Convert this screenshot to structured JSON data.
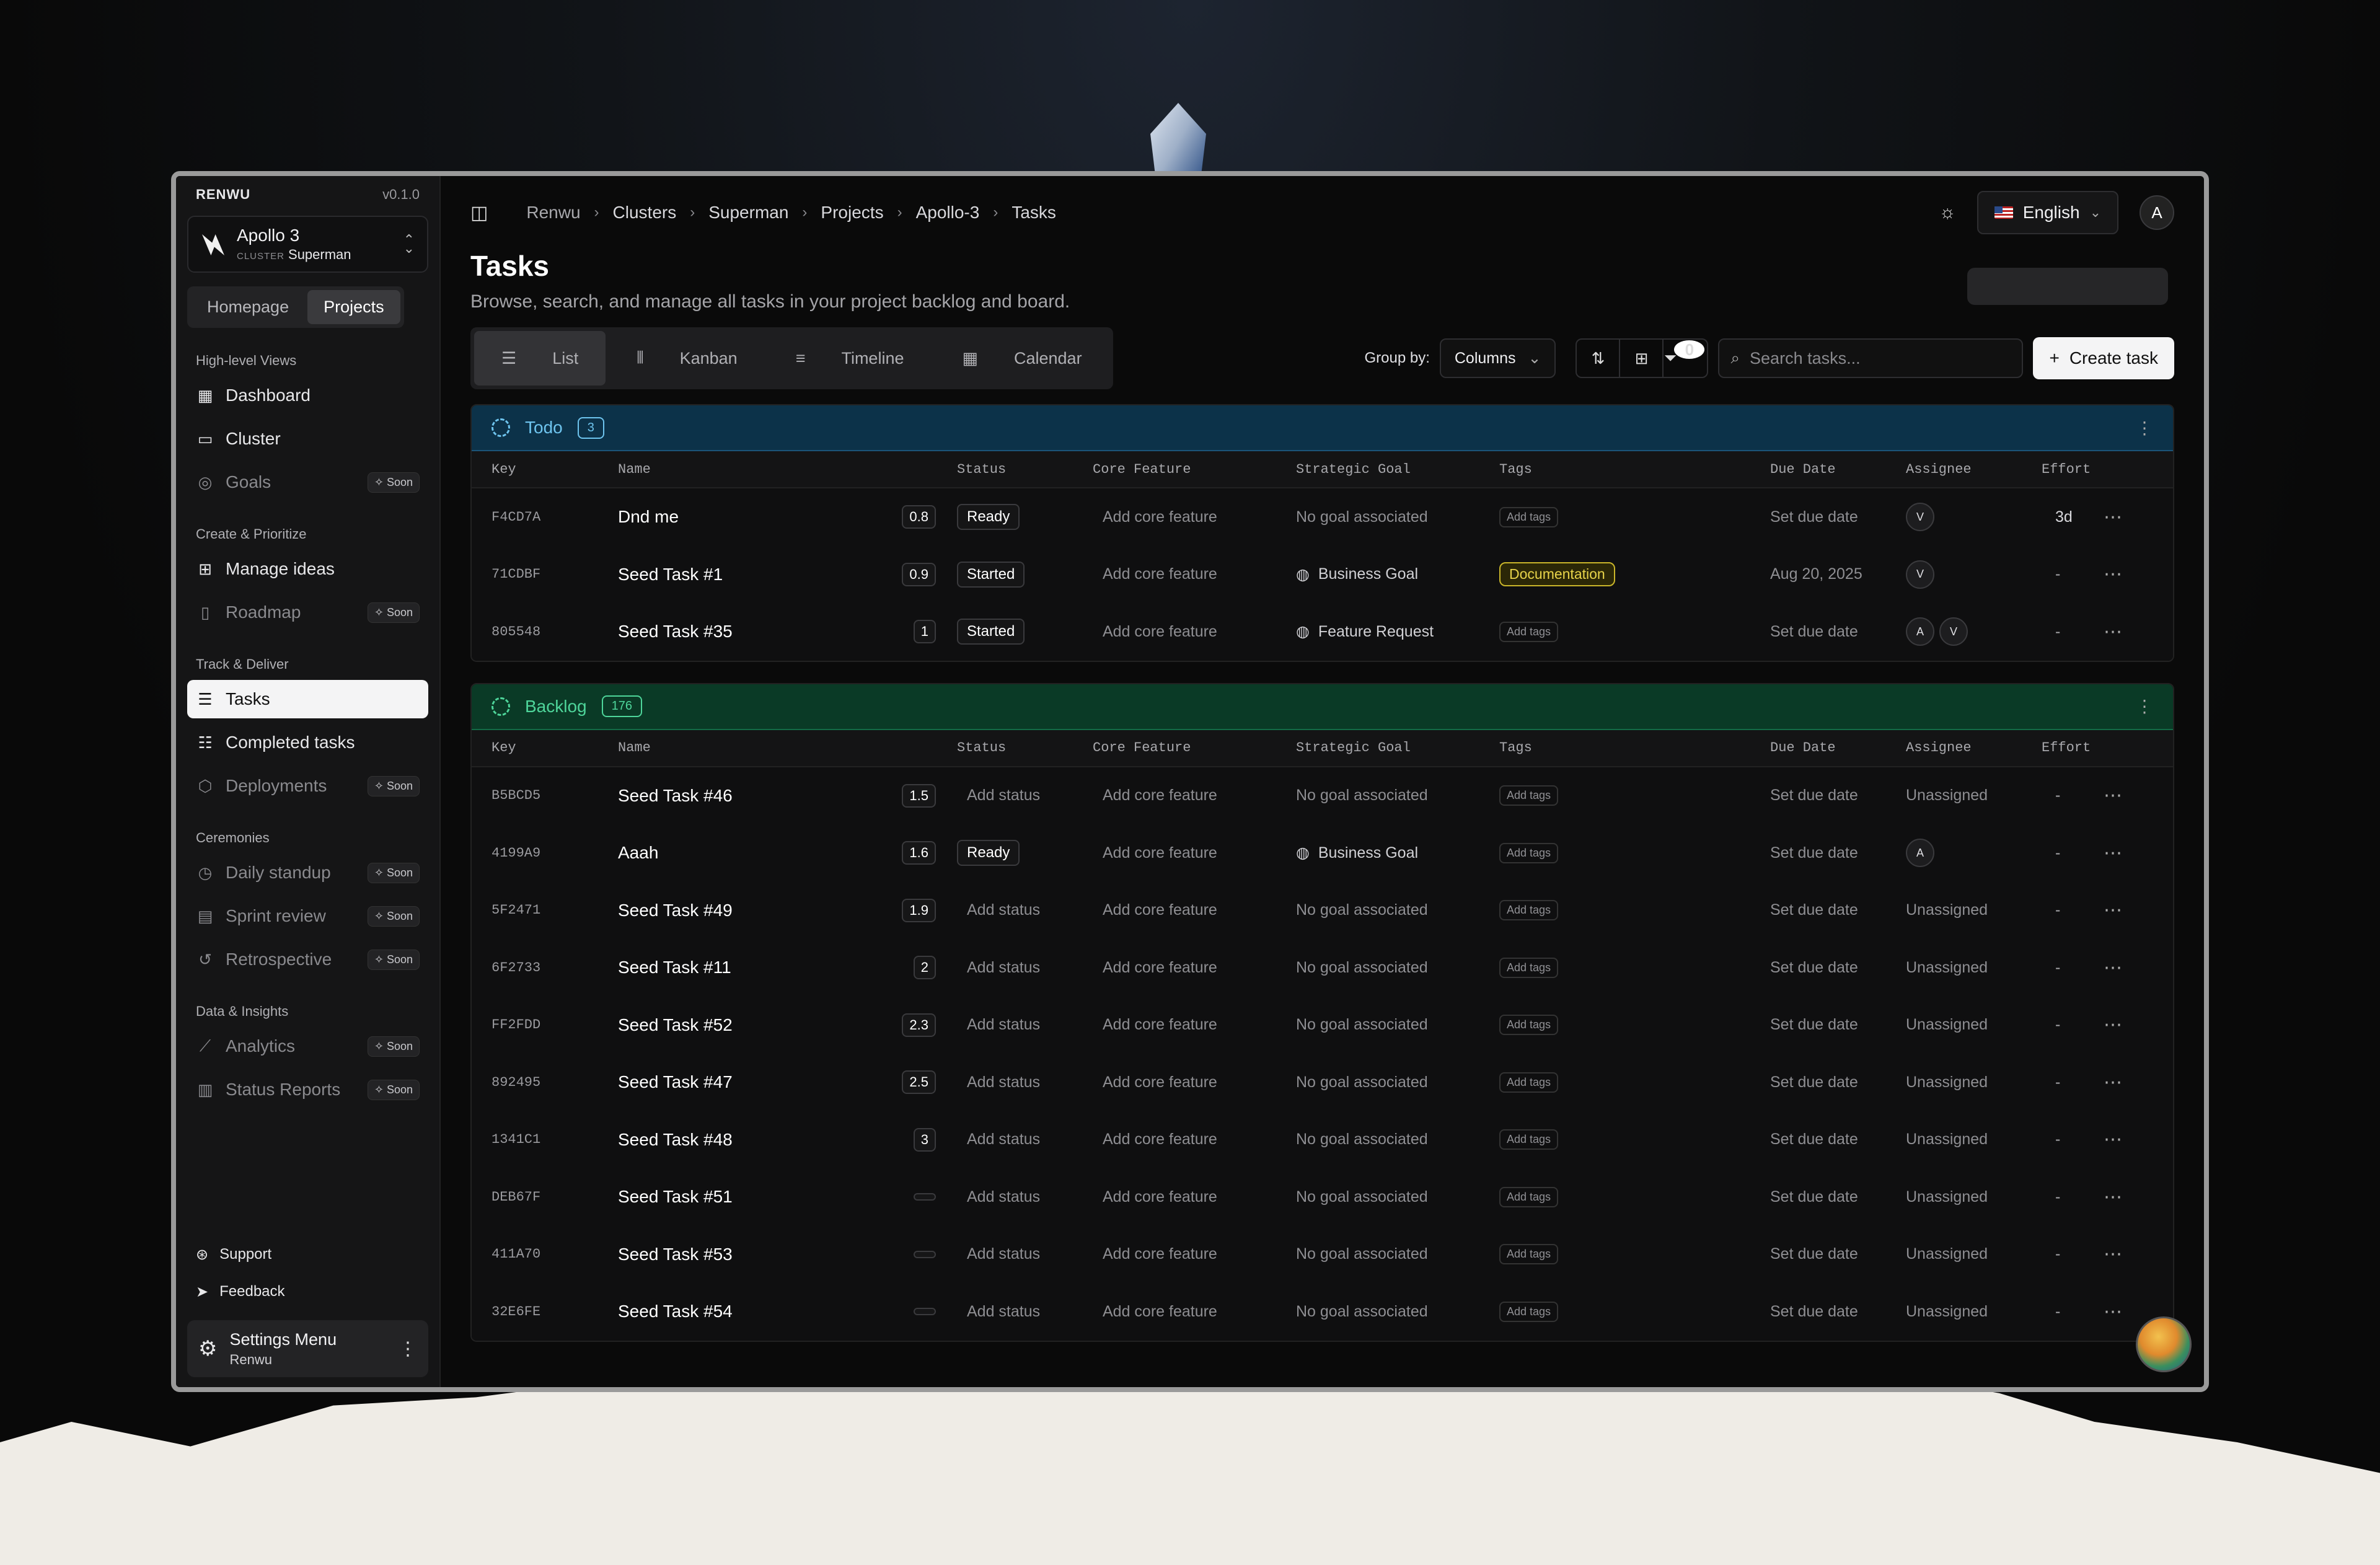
{
  "sidebar": {
    "brand": "RENWU",
    "version": "v0.1.0",
    "project": {
      "name": "Apollo 3",
      "cluster_tag": "CLUSTER",
      "cluster_name": "Superman"
    },
    "segments": [
      "Homepage",
      "Projects"
    ],
    "sections": [
      {
        "title": "High-level Views",
        "items": [
          {
            "label": "Dashboard",
            "soon": ""
          },
          {
            "label": "Cluster",
            "soon": ""
          },
          {
            "label": "Goals",
            "soon": "Soon"
          }
        ]
      },
      {
        "title": "Create & Prioritize",
        "items": [
          {
            "label": "Manage ideas",
            "soon": ""
          },
          {
            "label": "Roadmap",
            "soon": "Soon"
          }
        ]
      },
      {
        "title": "Track & Deliver",
        "items": [
          {
            "label": "Tasks",
            "soon": ""
          },
          {
            "label": "Completed tasks",
            "soon": ""
          },
          {
            "label": "Deployments",
            "soon": "Soon"
          }
        ]
      },
      {
        "title": "Ceremonies",
        "items": [
          {
            "label": "Daily standup",
            "soon": "Soon"
          },
          {
            "label": "Sprint review",
            "soon": "Soon"
          },
          {
            "label": "Retrospective",
            "soon": "Soon"
          }
        ]
      },
      {
        "title": "Data & Insights",
        "items": [
          {
            "label": "Analytics",
            "soon": "Soon"
          },
          {
            "label": "Status Reports",
            "soon": "Soon"
          }
        ]
      }
    ],
    "support": "Support",
    "feedback": "Feedback",
    "settings": {
      "title": "Settings Menu",
      "sub": "Renwu"
    }
  },
  "topbar": {
    "breadcrumbs": [
      "Renwu",
      "Clusters",
      "Superman",
      "Projects",
      "Apollo-3",
      "Tasks"
    ],
    "language": "English",
    "avatar": "A"
  },
  "page": {
    "title": "Tasks",
    "subtitle": "Browse, search, and manage all tasks in your project backlog and board."
  },
  "toolbar": {
    "views": [
      "List",
      "Kanban",
      "Timeline",
      "Calendar"
    ],
    "group_by_label": "Group by:",
    "group_by_value": "Columns",
    "filter_count": "0",
    "search_placeholder": "Search tasks...",
    "create_label": "Create task"
  },
  "columns": [
    "Key",
    "Name",
    "Status",
    "Core Feature",
    "Strategic Goal",
    "Tags",
    "Due Date",
    "Assignee",
    "Effort"
  ],
  "groups": [
    {
      "name": "Todo",
      "count": "3",
      "rows": [
        {
          "key": "F4CD7A",
          "name": "Dnd me",
          "score": "0.8",
          "status": "Ready",
          "feature": "Add core feature",
          "goal": "No goal associated",
          "tag": "Add tags",
          "due": "Set due date",
          "assignees": [
            "V"
          ],
          "effort": "3d"
        },
        {
          "key": "71CDBF",
          "name": "Seed Task #1",
          "score": "0.9",
          "status": "Started",
          "feature": "Add core feature",
          "goal": "Business Goal",
          "tag": "Documentation",
          "due": "Aug 20, 2025",
          "assignees": [
            "V"
          ],
          "effort": "-"
        },
        {
          "key": "805548",
          "name": "Seed Task #35",
          "score": "1",
          "status": "Started",
          "feature": "Add core feature",
          "goal": "Feature Request",
          "tag": "Add tags",
          "due": "Set due date",
          "assignees": [
            "A",
            "V"
          ],
          "effort": "-"
        }
      ]
    },
    {
      "name": "Backlog",
      "count": "176",
      "rows": [
        {
          "key": "B5BCD5",
          "name": "Seed Task #46",
          "score": "1.5",
          "status": "Add status",
          "feature": "Add core feature",
          "goal": "No goal associated",
          "tag": "Add tags",
          "due": "Set due date",
          "assignee_text": "Unassigned",
          "effort": "-"
        },
        {
          "key": "4199A9",
          "name": "Aaah",
          "score": "1.6",
          "status": "Ready",
          "feature": "Add core feature",
          "goal": "Business Goal",
          "tag": "Add tags",
          "due": "Set due date",
          "assignees": [
            "A"
          ],
          "effort": "-"
        },
        {
          "key": "5F2471",
          "name": "Seed Task #49",
          "score": "1.9",
          "status": "Add status",
          "feature": "Add core feature",
          "goal": "No goal associated",
          "tag": "Add tags",
          "due": "Set due date",
          "assignee_text": "Unassigned",
          "effort": "-"
        },
        {
          "key": "6F2733",
          "name": "Seed Task #11",
          "score": "2",
          "status": "Add status",
          "feature": "Add core feature",
          "goal": "No goal associated",
          "tag": "Add tags",
          "due": "Set due date",
          "assignee_text": "Unassigned",
          "effort": "-"
        },
        {
          "key": "FF2FDD",
          "name": "Seed Task #52",
          "score": "2.3",
          "status": "Add status",
          "feature": "Add core feature",
          "goal": "No goal associated",
          "tag": "Add tags",
          "due": "Set due date",
          "assignee_text": "Unassigned",
          "effort": "-"
        },
        {
          "key": "892495",
          "name": "Seed Task #47",
          "score": "2.5",
          "status": "Add status",
          "feature": "Add core feature",
          "goal": "No goal associated",
          "tag": "Add tags",
          "due": "Set due date",
          "assignee_text": "Unassigned",
          "effort": "-"
        },
        {
          "key": "1341C1",
          "name": "Seed Task #48",
          "score": "3",
          "status": "Add status",
          "feature": "Add core feature",
          "goal": "No goal associated",
          "tag": "Add tags",
          "due": "Set due date",
          "assignee_text": "Unassigned",
          "effort": "-"
        },
        {
          "key": "DEB67F",
          "name": "Seed Task #51",
          "score": "",
          "status": "Add status",
          "feature": "Add core feature",
          "goal": "No goal associated",
          "tag": "Add tags",
          "due": "Set due date",
          "assignee_text": "Unassigned",
          "effort": "-"
        },
        {
          "key": "411A70",
          "name": "Seed Task #53",
          "score": "",
          "status": "Add status",
          "feature": "Add core feature",
          "goal": "No goal associated",
          "tag": "Add tags",
          "due": "Set due date",
          "assignee_text": "Unassigned",
          "effort": "-"
        },
        {
          "key": "32E6FE",
          "name": "Seed Task #54",
          "score": "",
          "status": "Add status",
          "feature": "Add core feature",
          "goal": "No goal associated",
          "tag": "Add tags",
          "due": "Set due date",
          "assignee_text": "Unassigned",
          "effort": "-"
        }
      ]
    }
  ],
  "icons": {
    "sidebar_toggle": "sidebar-toggle-icon",
    "theme": "sun-icon",
    "search": "search-icon",
    "filter": "filter-icon",
    "sort": "sort-icon",
    "grid": "grid-icon"
  },
  "colors": {
    "todo_accent": "#6ec4ee",
    "backlog_accent": "#4ed59a",
    "tag_documentation": "#e7d34a"
  }
}
